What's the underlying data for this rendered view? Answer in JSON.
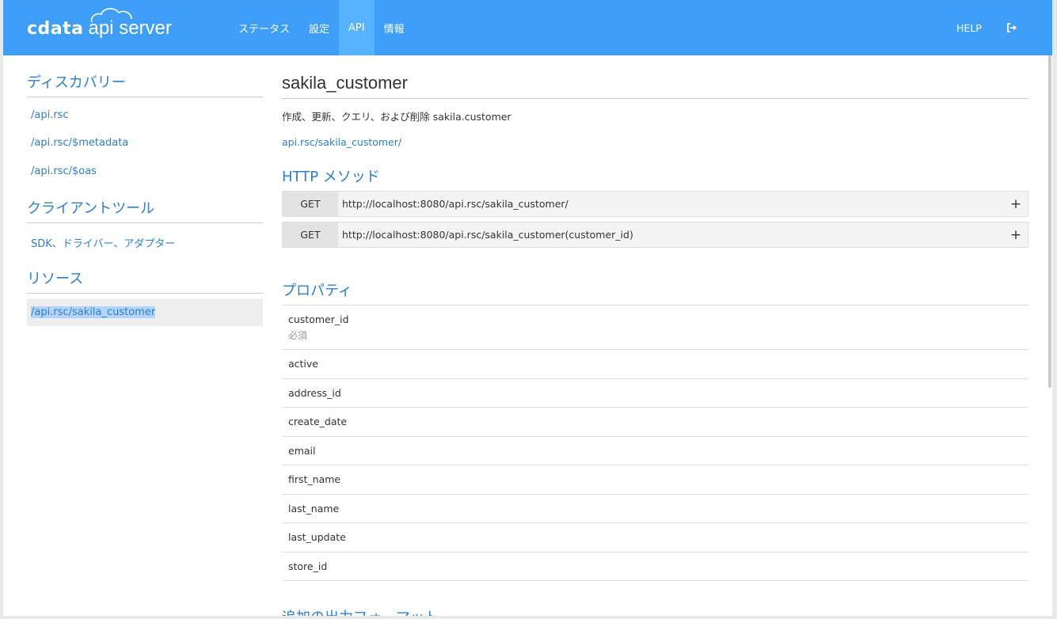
{
  "logo": {
    "brand": "cdata",
    "product": "api server"
  },
  "nav": [
    {
      "label": "ステータス"
    },
    {
      "label": "設定"
    },
    {
      "label": "API"
    },
    {
      "label": "情報"
    }
  ],
  "help_label": "HELP",
  "sidebar": {
    "discovery_heading": "ディスカバリー",
    "discovery_links": [
      "/api.rsc",
      "/api.rsc/$metadata",
      "/api.rsc/$oas"
    ],
    "client_heading": "クライアントツール",
    "client_link": "SDK、ドライバー、アダプター",
    "resources_heading": "リソース",
    "resource_selected": "/api.rsc/sakila_customer"
  },
  "main": {
    "title": "sakila_customer",
    "description": "作成、更新、クエリ、および削除 sakila.customer",
    "link": "api.rsc/sakila_customer/",
    "http_heading": "HTTP メソッド",
    "methods": [
      {
        "verb": "GET",
        "url": "http://localhost:8080/api.rsc/sakila_customer/",
        "action": "+"
      },
      {
        "verb": "GET",
        "url": "http://localhost:8080/api.rsc/sakila_customer(customer_id)",
        "action": "+"
      }
    ],
    "properties_heading": "プロパティ",
    "first_property": {
      "name": "customer_id",
      "note": "必須"
    },
    "properties": [
      "active",
      "address_id",
      "create_date",
      "email",
      "first_name",
      "last_name",
      "last_update",
      "store_id"
    ],
    "cut_heading": "追加の出力フォーマット"
  },
  "colors": {
    "topbar": "#3e9ef8",
    "nav_active": "#55b3ff",
    "link": "#2a7fd0"
  }
}
